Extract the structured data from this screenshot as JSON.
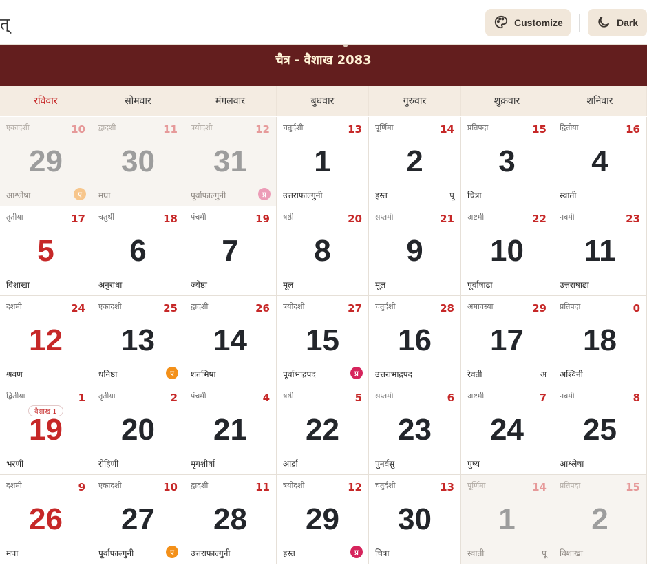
{
  "topbar": {
    "title": "त्",
    "customize_label": "Customize",
    "dark_label": "Dark"
  },
  "calendar": {
    "month_title": "चैत्र - वैशाख 2083",
    "weekdays": [
      "रविवार",
      "सोमवार",
      "मंगलवार",
      "बुधवार",
      "गुरुवार",
      "शुक्रवार",
      "शनिवार"
    ],
    "colors": {
      "header_bg": "#631e1e",
      "accent_red": "#c62828",
      "ekadashi_badge": "#f39019",
      "pradosh_badge": "#d6245c"
    },
    "cells": [
      {
        "tithi": "एकादशी",
        "tnum": "10",
        "day": "29",
        "nak": "आश्लेषा",
        "badge": "ए",
        "faded": true
      },
      {
        "tithi": "द्वादशी",
        "tnum": "11",
        "day": "30",
        "nak": "मघा",
        "faded": true
      },
      {
        "tithi": "त्रयोदशी",
        "tnum": "12",
        "day": "31",
        "nak": "पूर्वाफाल्गुनी",
        "badge": "प्र",
        "faded": true
      },
      {
        "tithi": "चतुर्दशी",
        "tnum": "13",
        "day": "1",
        "nak": "उत्तराफाल्गुनी"
      },
      {
        "tithi": "पूर्णिमा",
        "tnum": "14",
        "day": "2",
        "nak": "हस्त",
        "mark": "पू"
      },
      {
        "tithi": "प्रतिपदा",
        "tnum": "15",
        "day": "3",
        "nak": "चित्रा"
      },
      {
        "tithi": "द्वितीया",
        "tnum": "16",
        "day": "4",
        "nak": "स्वाती"
      },
      {
        "tithi": "तृतीया",
        "tnum": "17",
        "day": "5",
        "nak": "विशाखा",
        "sunday": true
      },
      {
        "tithi": "चतुर्थी",
        "tnum": "18",
        "day": "6",
        "nak": "अनुराधा"
      },
      {
        "tithi": "पंचमी",
        "tnum": "19",
        "day": "7",
        "nak": "ज्येष्ठा"
      },
      {
        "tithi": "षष्ठी",
        "tnum": "20",
        "day": "8",
        "nak": "मूल"
      },
      {
        "tithi": "सप्तमी",
        "tnum": "21",
        "day": "9",
        "nak": "मूल"
      },
      {
        "tithi": "अष्टमी",
        "tnum": "22",
        "day": "10",
        "nak": "पूर्वाषाढा"
      },
      {
        "tithi": "नवमी",
        "tnum": "23",
        "day": "11",
        "nak": "उत्तराषाढा"
      },
      {
        "tithi": "दशमी",
        "tnum": "24",
        "day": "12",
        "nak": "श्रवण",
        "sunday": true
      },
      {
        "tithi": "एकादशी",
        "tnum": "25",
        "day": "13",
        "nak": "धनिष्ठा",
        "badge": "ए"
      },
      {
        "tithi": "द्वादशी",
        "tnum": "26",
        "day": "14",
        "nak": "शतभिषा"
      },
      {
        "tithi": "त्रयोदशी",
        "tnum": "27",
        "day": "15",
        "nak": "पूर्वाभाद्रपद",
        "badge": "प्र"
      },
      {
        "tithi": "चतुर्दशी",
        "tnum": "28",
        "day": "16",
        "nak": "उत्तराभाद्रपद"
      },
      {
        "tithi": "अमावस्या",
        "tnum": "29",
        "day": "17",
        "nak": "रेवती",
        "mark": "अ"
      },
      {
        "tithi": "प्रतिपदा",
        "tnum": "0",
        "day": "18",
        "nak": "अश्विनी"
      },
      {
        "tithi": "द्वितीया",
        "tnum": "1",
        "day": "19",
        "nak": "भरणी",
        "sunday": true,
        "pill": "वैशाख 1"
      },
      {
        "tithi": "तृतीया",
        "tnum": "2",
        "day": "20",
        "nak": "रोहिणी"
      },
      {
        "tithi": "पंचमी",
        "tnum": "4",
        "day": "21",
        "nak": "मृगशीर्षा"
      },
      {
        "tithi": "षष्ठी",
        "tnum": "5",
        "day": "22",
        "nak": "आर्द्रा"
      },
      {
        "tithi": "सप्तमी",
        "tnum": "6",
        "day": "23",
        "nak": "पुनर्वसु"
      },
      {
        "tithi": "अष्टमी",
        "tnum": "7",
        "day": "24",
        "nak": "पुष्य"
      },
      {
        "tithi": "नवमी",
        "tnum": "8",
        "day": "25",
        "nak": "आश्लेषा"
      },
      {
        "tithi": "दशमी",
        "tnum": "9",
        "day": "26",
        "nak": "मघा",
        "sunday": true
      },
      {
        "tithi": "एकादशी",
        "tnum": "10",
        "day": "27",
        "nak": "पूर्वाफाल्गुनी",
        "badge": "ए"
      },
      {
        "tithi": "द्वादशी",
        "tnum": "11",
        "day": "28",
        "nak": "उत्तराफाल्गुनी"
      },
      {
        "tithi": "त्रयोदशी",
        "tnum": "12",
        "day": "29",
        "nak": "हस्त",
        "badge": "प्र"
      },
      {
        "tithi": "चतुर्दशी",
        "tnum": "13",
        "day": "30",
        "nak": "चित्रा"
      },
      {
        "tithi": "पूर्णिमा",
        "tnum": "14",
        "day": "1",
        "nak": "स्वाती",
        "mark": "पू",
        "faded": true
      },
      {
        "tithi": "प्रतिपदा",
        "tnum": "15",
        "day": "2",
        "nak": "विशाखा",
        "faded": true
      }
    ]
  }
}
